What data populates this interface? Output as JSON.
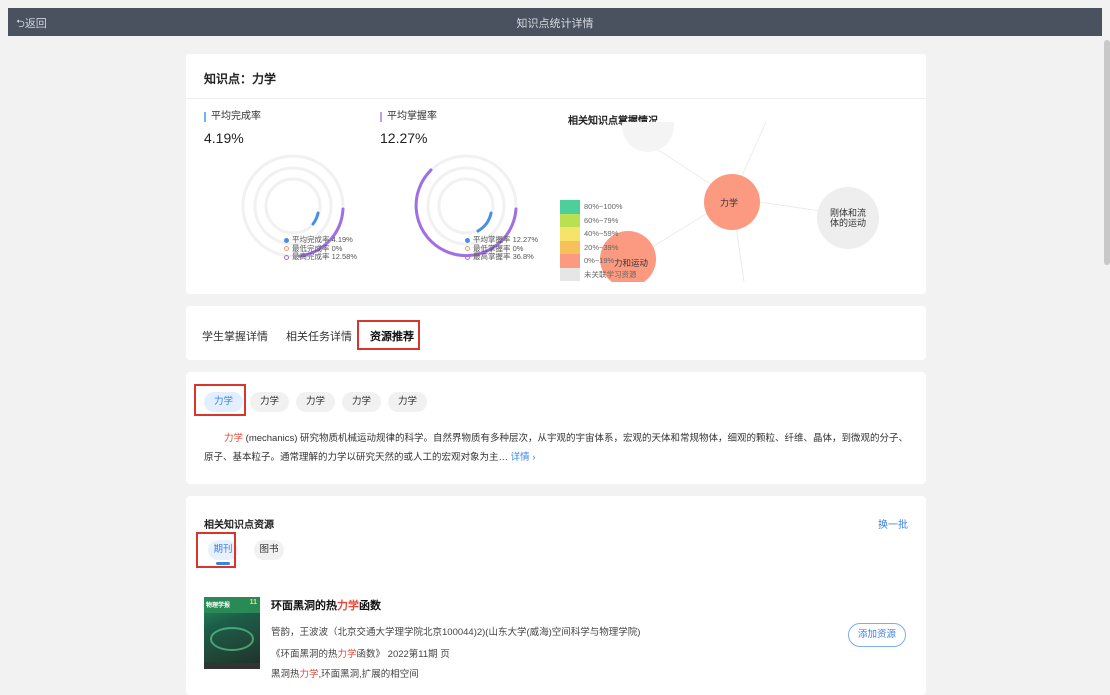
{
  "header": {
    "back_label": "返回",
    "title": "知识点统计详情"
  },
  "knowledge": {
    "title": "知识点：力学"
  },
  "metrics": {
    "completion": {
      "label": "平均完成率",
      "value": "4.19%",
      "legend": [
        "平均完成率 4.19%",
        "最低完成率 0%",
        "最高完成率 12.58%"
      ]
    },
    "mastery": {
      "label": "平均掌握率",
      "value": "12.27%",
      "legend": [
        "平均掌握率 12.27%",
        "最低掌握率 0%",
        "最高掌握率 36.8%"
      ]
    }
  },
  "graph": {
    "title": "相关知识点掌握情况",
    "legend": [
      {
        "label": "80%~100%",
        "color": "#4ccf9a"
      },
      {
        "label": "60%~79%",
        "color": "#b8e050"
      },
      {
        "label": "40%~59%",
        "color": "#f5e36a"
      },
      {
        "label": "20%~39%",
        "color": "#f8c05a"
      },
      {
        "label": "0%~19%",
        "color": "#fb9a80"
      },
      {
        "label": "未关联学习资源",
        "color": "#e6e6e6"
      }
    ],
    "nodes": {
      "center": "力学",
      "right": [
        "刚体和流",
        "体的运动"
      ],
      "bottom": "力和运动"
    }
  },
  "tabs": [
    "学生掌握详情",
    "相关任务详情",
    "资源推荐"
  ],
  "chips": [
    "力学",
    "力学",
    "力学",
    "力学",
    "力学"
  ],
  "description": {
    "term": "力学",
    "text": "(mechanics) 研究物质机械运动规律的科学。自然界物质有多种层次，从宇观的宇宙体系，宏观的天体和常规物体，细观的颗粒、纤维、晶体，到微观的分子、原子、基本粒子。通常理解的力学以研究天然的或人工的宏观对象为主…",
    "more": "详情"
  },
  "resources": {
    "title": "相关知识点资源",
    "refresh": "换一批",
    "tabs": [
      "期刊",
      "图书"
    ],
    "article": {
      "cover_title": "物理学报",
      "cover_number": "11",
      "title_pre": "环面黑洞的热",
      "title_hl": "力学",
      "title_post": "函数",
      "authors": "管韵，王波波（北京交通大学理学院北京100044)2)(山东大学(威海)空间科学与物理学院)",
      "source_pre": "《环面黑洞的热",
      "source_hl": "力学",
      "source_post": "函数》 2022第11期 页",
      "kw_pre": "黑洞热",
      "kw_hl": "力学",
      "kw_post": ",环面黑洞,扩展的相空间",
      "add_label": "添加资源"
    }
  }
}
